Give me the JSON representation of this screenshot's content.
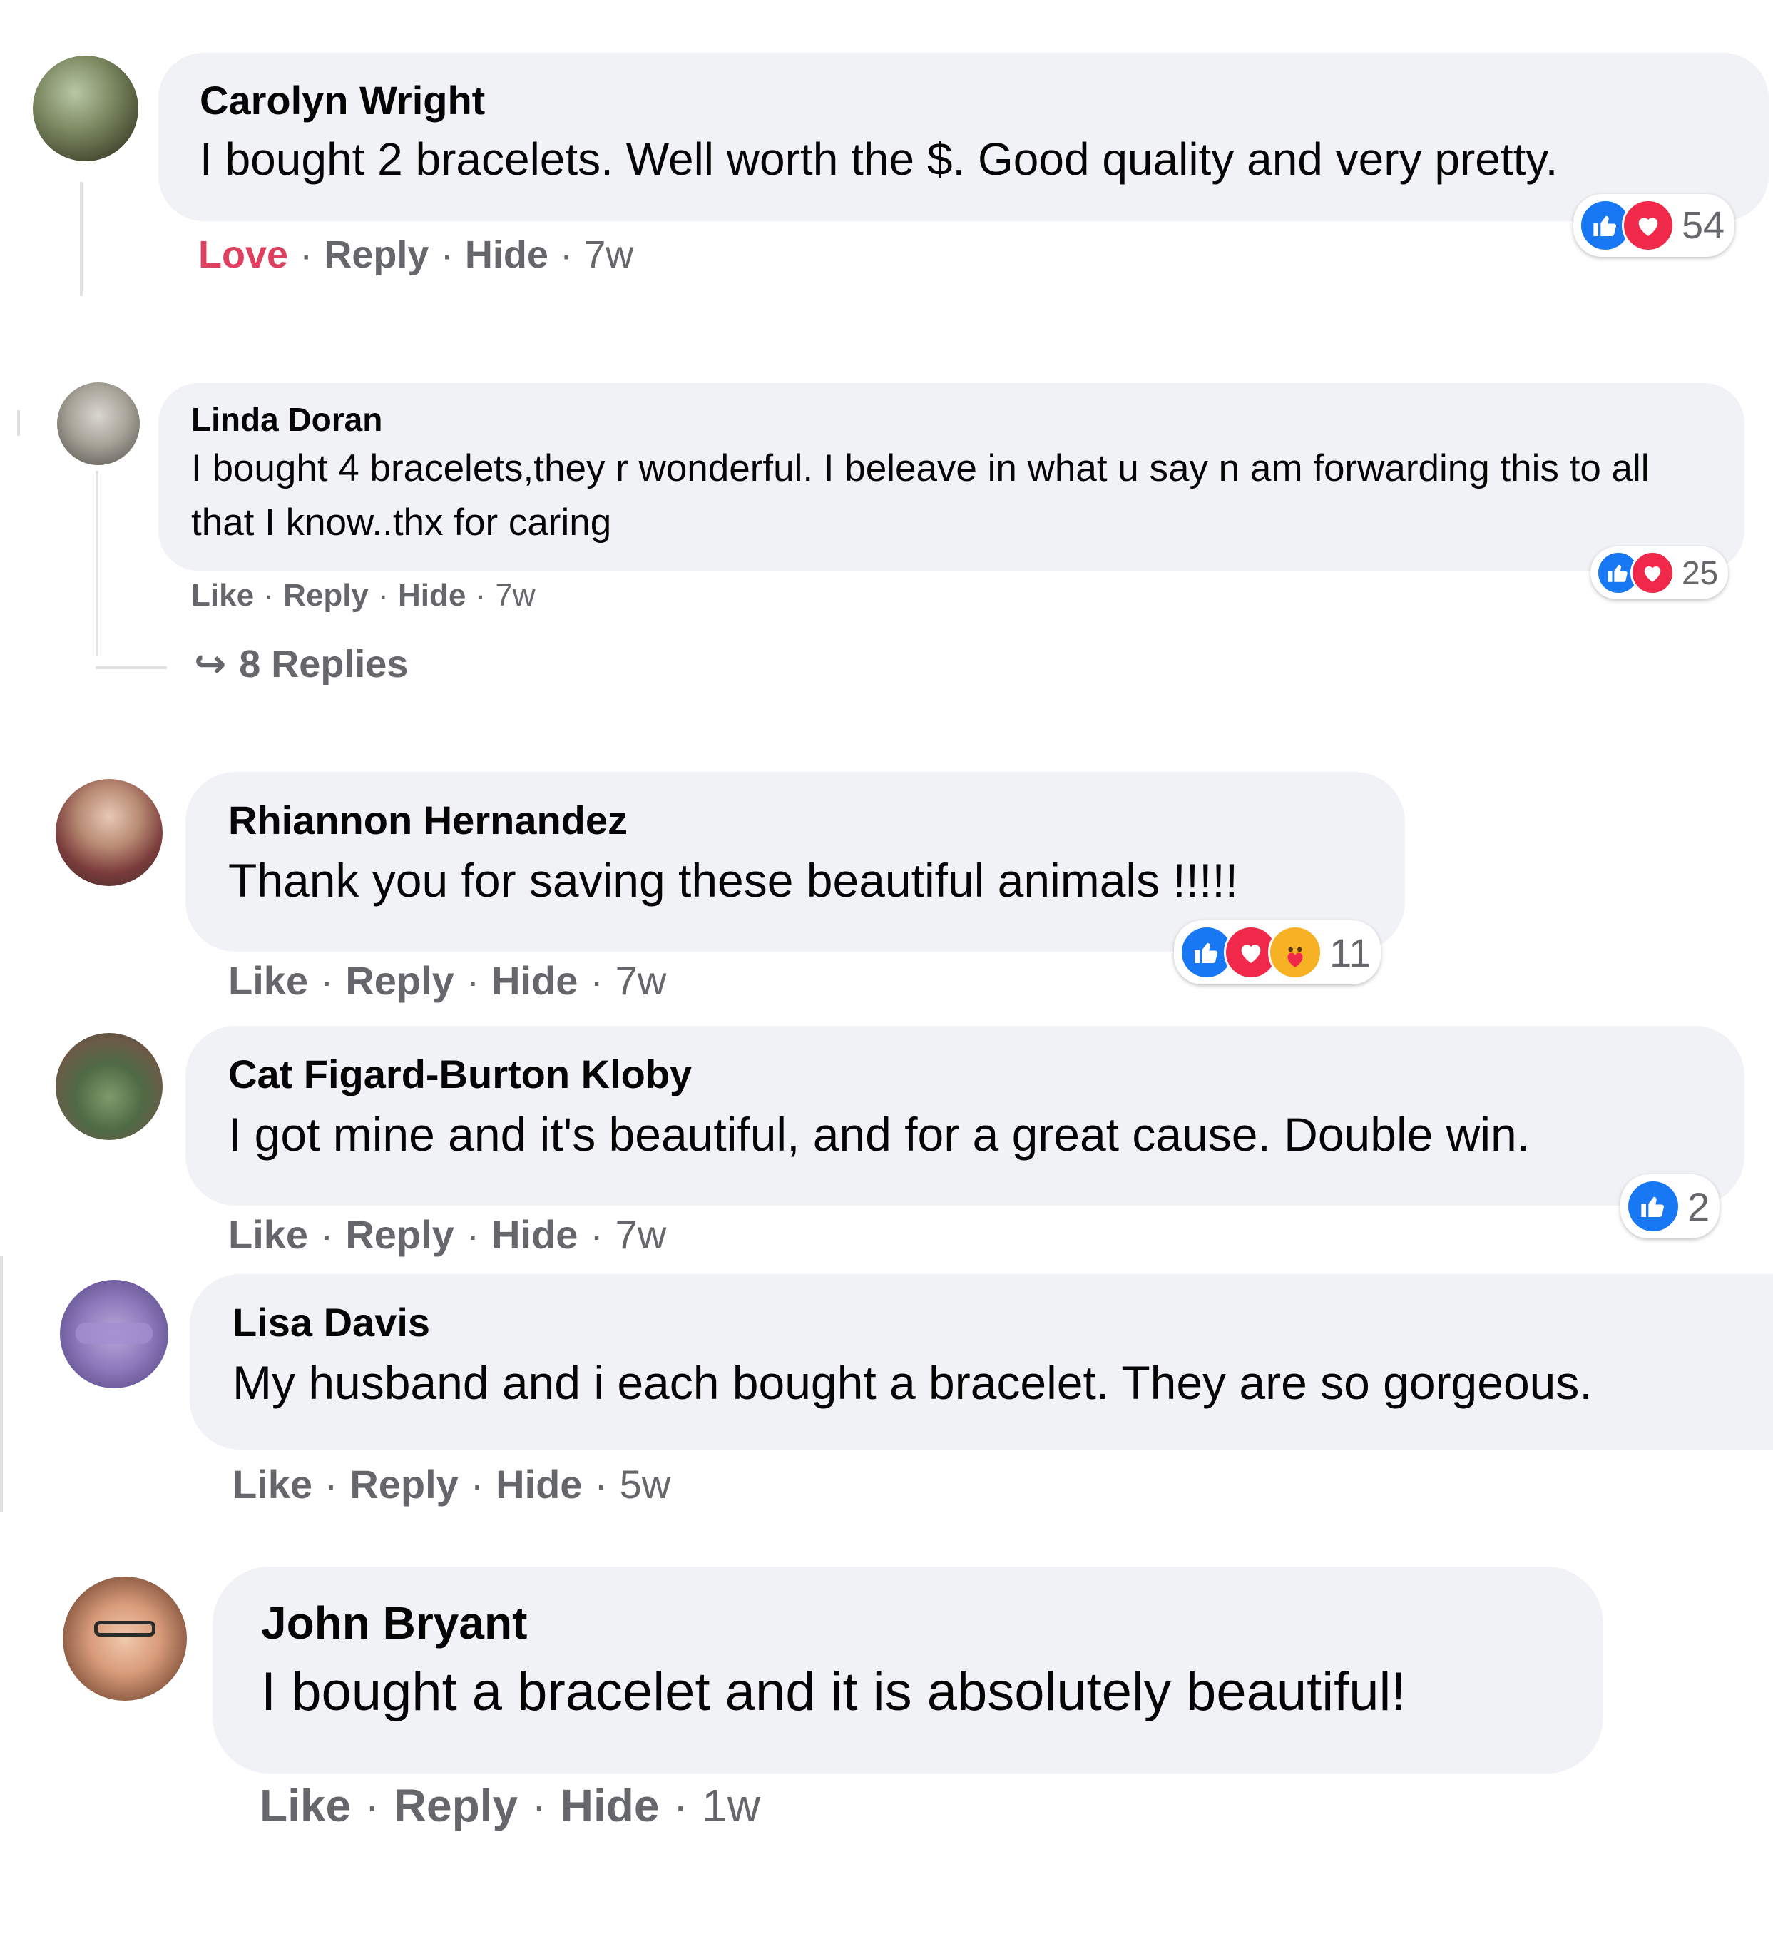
{
  "colors": {
    "bubble": "#f0f2f5",
    "meta_text": "#65676b",
    "like_blue": "#1877f2",
    "love_red": "#f02849",
    "love_label": "#e0405f",
    "care_yellow": "#f7b125"
  },
  "action_labels": {
    "like": "Like",
    "love": "Love",
    "reply": "Reply",
    "hide": "Hide",
    "dot": "·"
  },
  "comments": [
    {
      "author": "Carolyn Wright",
      "text": "I bought 2 bracelets. Well worth the $. Good quality and very pretty.",
      "time": "7w",
      "reaction_count": "54",
      "reactions": [
        "like-icon",
        "love-icon"
      ]
    },
    {
      "author": "Linda Doran",
      "text": "I bought 4 bracelets,they r wonderful. I beleave in what u say n am forwarding this to all that I know..thx for caring",
      "time": "7w",
      "reaction_count": "25",
      "reactions": [
        "like-icon",
        "love-icon"
      ],
      "replies_label": "8 Replies"
    },
    {
      "author": "Rhiannon Hernandez",
      "text": "Thank you for saving these beautiful animals !!!!!",
      "time": "7w",
      "reaction_count": "11",
      "reactions": [
        "like-icon",
        "love-icon",
        "care-icon"
      ]
    },
    {
      "author": "Cat Figard-Burton Kloby",
      "text": "I got mine and it's beautiful, and for a great cause. Double win.",
      "time": "7w",
      "reaction_count": "2",
      "reactions": [
        "like-icon"
      ]
    },
    {
      "author": "Lisa Davis",
      "text": "My husband and i each bought a bracelet. They are so gorgeous.",
      "time": "5w"
    },
    {
      "author": "John Bryant",
      "text": "I bought a bracelet and it is absolutely beautiful!",
      "time": "1w"
    }
  ]
}
